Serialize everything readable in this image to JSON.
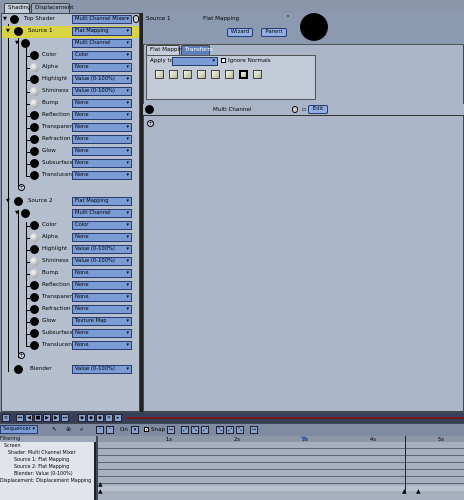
{
  "tabs": [
    {
      "label": "Shading"
    },
    {
      "label": "Displacement"
    }
  ],
  "top_shader": {
    "label": "Top Shader",
    "value": "Multi Channel Mixer"
  },
  "source1": {
    "label": "Source 1",
    "value": "Flat Mapping",
    "sub": "Multi Channel",
    "channels": [
      {
        "label": "Color",
        "value": "Color"
      },
      {
        "label": "Alpha",
        "value": "None"
      },
      {
        "label": "Highlight",
        "value": "Value (0-100%)"
      },
      {
        "label": "Shininess",
        "value": "Value (0-100%)"
      },
      {
        "label": "Bump",
        "value": "None"
      },
      {
        "label": "Reflection",
        "value": "None"
      },
      {
        "label": "Transparency",
        "value": "None"
      },
      {
        "label": "Refraction",
        "value": "None"
      },
      {
        "label": "Glow",
        "value": "None"
      },
      {
        "label": "Subsurface Sc",
        "value": "None"
      },
      {
        "label": "Translucency",
        "value": "None"
      }
    ]
  },
  "source2": {
    "label": "Source 2",
    "value": "Flat Mapping",
    "sub": "Multi Channel",
    "channels": [
      {
        "label": "Color",
        "value": "Color"
      },
      {
        "label": "Alpha",
        "value": "None"
      },
      {
        "label": "Highlight",
        "value": "Value (0-100%)"
      },
      {
        "label": "Shininess",
        "value": "Value (0-100%)"
      },
      {
        "label": "Bump",
        "value": "None"
      },
      {
        "label": "Reflection",
        "value": "None"
      },
      {
        "label": "Transparency",
        "value": "None"
      },
      {
        "label": "Refraction",
        "value": "None"
      },
      {
        "label": "Glow",
        "value": "Texture Map"
      },
      {
        "label": "Subsurface Sc",
        "value": "None"
      },
      {
        "label": "Translucency",
        "value": "None"
      }
    ]
  },
  "blender": {
    "label": "Blender",
    "value": "Value (0-100%)"
  },
  "right": {
    "source_label": "Source 1",
    "mapping_label": "Flat Mapping",
    "wizard": "Wizard",
    "parent": "Parent",
    "subtabs": [
      {
        "label": "Flat Mapping"
      },
      {
        "label": "Transform"
      }
    ],
    "apply_to": "Apply to:",
    "ignore_normals": "Ignore Normals",
    "multi_channel": "Multi Channel",
    "edit": "Edit"
  },
  "timeline": {
    "mode": "Sequencer",
    "on_label": "On",
    "snap_label": "Snap",
    "filter": "Filtering",
    "ticks": [
      "1s",
      "2s",
      "3s",
      "4s",
      "5s"
    ],
    "tree": [
      "Screen",
      "Shader: Multi Channel Mixer",
      "Source 1: Flat Mapping",
      "Source 2: Flat Mapping",
      "Blender: Value (0-100%)",
      "Displacement: Displacement Mapping"
    ]
  }
}
